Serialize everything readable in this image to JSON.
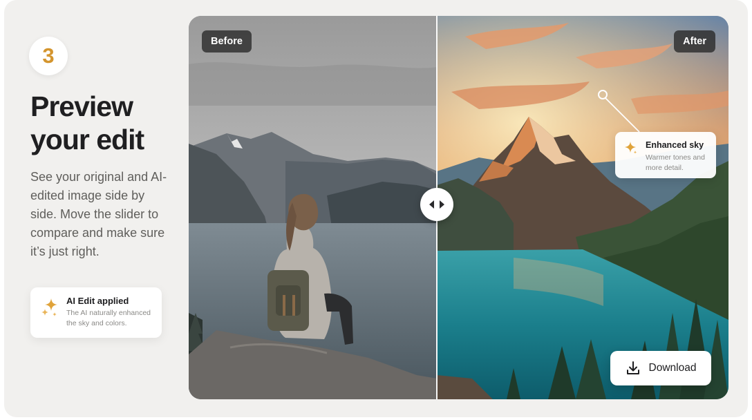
{
  "step": {
    "number": "3"
  },
  "headline": {
    "line1": "Preview",
    "line2": "your edit"
  },
  "description": "See your original and AI-edited image side by side. Move the slider to compare and make sure it’s just right.",
  "applied_card": {
    "icon": "sparkle-icon",
    "title": "AI Edit applied",
    "subtitle": "The AI naturally enhanced the sky and colors."
  },
  "compare": {
    "before_label": "Before",
    "after_label": "After",
    "slider_position": 0.46,
    "callout": {
      "icon": "sparkle-icon",
      "title": "Enhanced sky",
      "subtitle": "Warmer tones and more detail."
    },
    "download_label": "Download"
  },
  "colors": {
    "accent": "#d4952e",
    "background": "#f1f0ee",
    "pill": "#2a2a2a"
  }
}
